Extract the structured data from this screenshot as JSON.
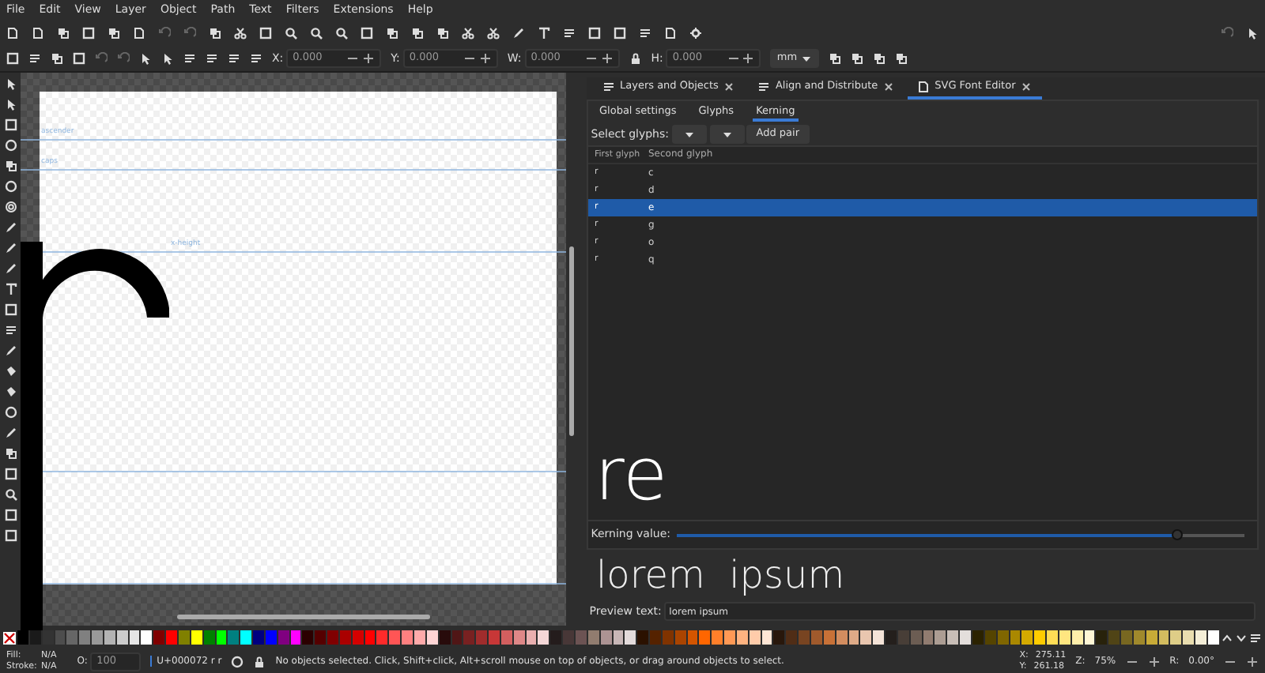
{
  "menu": [
    "File",
    "Edit",
    "View",
    "Layer",
    "Object",
    "Path",
    "Text",
    "Filters",
    "Extensions",
    "Help"
  ],
  "tool_controls": {
    "fields": [
      {
        "label": "X:",
        "value": "0.000"
      },
      {
        "label": "Y:",
        "value": "0.000"
      },
      {
        "label": "W:",
        "value": "0.000"
      },
      {
        "label": "H:",
        "value": "0.000"
      }
    ],
    "unit": "mm"
  },
  "canvas": {
    "guides": [
      {
        "label": "ascender"
      },
      {
        "label": "caps"
      },
      {
        "label": "x-height"
      }
    ]
  },
  "dock": {
    "tabs": [
      {
        "label": "Layers and Objects",
        "selected": false
      },
      {
        "label": "Align and Distribute",
        "selected": false
      },
      {
        "label": "SVG Font Editor",
        "selected": true
      }
    ],
    "subtabs": [
      {
        "label": "Global settings",
        "selected": false
      },
      {
        "label": "Glyphs",
        "selected": false
      },
      {
        "label": "Kerning",
        "selected": true
      }
    ],
    "select_label": "Select glyphs:",
    "add_pair": "Add pair",
    "columns": [
      "First glyph",
      "Second glyph"
    ],
    "rows": [
      {
        "first": "r",
        "second": "c",
        "selected": false
      },
      {
        "first": "r",
        "second": "d",
        "selected": false
      },
      {
        "first": "r",
        "second": "e",
        "selected": true
      },
      {
        "first": "r",
        "second": "g",
        "selected": false
      },
      {
        "first": "r",
        "second": "o",
        "selected": false
      },
      {
        "first": "r",
        "second": "q",
        "selected": false
      }
    ],
    "pair_preview": "re",
    "kerning": {
      "label": "Kerning value:",
      "level": 0.88
    },
    "text_preview": "lorem  ipsum",
    "preview_text": {
      "label": "Preview text:",
      "value": "lorem ipsum"
    }
  },
  "palette": [
    {
      "color": "#000000"
    },
    {
      "color": "#1a1a1a"
    },
    {
      "color": "#333333"
    },
    {
      "color": "#4d4d4d"
    },
    {
      "color": "#666666"
    },
    {
      "color": "#808080"
    },
    {
      "color": "#999999"
    },
    {
      "color": "#b3b3b3"
    },
    {
      "color": "#cccccc"
    },
    {
      "color": "#e6e6e6"
    },
    {
      "color": "#ffffff"
    },
    {
      "color": "#800000"
    },
    {
      "color": "#ff0000"
    },
    {
      "color": "#808000"
    },
    {
      "color": "#ffff00"
    },
    {
      "color": "#008000"
    },
    {
      "color": "#00ff00"
    },
    {
      "color": "#008080"
    },
    {
      "color": "#00ffff"
    },
    {
      "color": "#000080"
    },
    {
      "color": "#0000ff"
    },
    {
      "color": "#800080"
    },
    {
      "color": "#ff00ff"
    },
    {
      "color": "#2b0000"
    },
    {
      "color": "#550000"
    },
    {
      "color": "#800001"
    },
    {
      "color": "#aa0000"
    },
    {
      "color": "#d40000"
    },
    {
      "color": "#ff0001"
    },
    {
      "color": "#ff2a2a"
    },
    {
      "color": "#ff5555"
    },
    {
      "color": "#ff8080"
    },
    {
      "color": "#ffaaaa"
    },
    {
      "color": "#ffd5d5"
    },
    {
      "color": "#280b0b"
    },
    {
      "color": "#501616"
    },
    {
      "color": "#782121"
    },
    {
      "color": "#a02c2c"
    },
    {
      "color": "#c83737"
    },
    {
      "color": "#d35f5f"
    },
    {
      "color": "#de8787"
    },
    {
      "color": "#e9afaf"
    },
    {
      "color": "#f4d7d7"
    },
    {
      "color": "#241c1c"
    },
    {
      "color": "#483737"
    },
    {
      "color": "#6c5353"
    },
    {
      "color": "#917c6f"
    },
    {
      "color": "#ac9393"
    },
    {
      "color": "#c8b7b7"
    },
    {
      "color": "#e3dbdb"
    },
    {
      "color": "#2b1100"
    },
    {
      "color": "#552200"
    },
    {
      "color": "#803300"
    },
    {
      "color": "#aa4400"
    },
    {
      "color": "#d45500"
    },
    {
      "color": "#ff6600"
    },
    {
      "color": "#ff7f2a"
    },
    {
      "color": "#ff9955"
    },
    {
      "color": "#ffb380"
    },
    {
      "color": "#ffccaa"
    },
    {
      "color": "#ffe6d5"
    },
    {
      "color": "#28170b"
    },
    {
      "color": "#502d16"
    },
    {
      "color": "#784421"
    },
    {
      "color": "#a05a2c"
    },
    {
      "color": "#c87137"
    },
    {
      "color": "#d38d5f"
    },
    {
      "color": "#deaa87"
    },
    {
      "color": "#e9c6af"
    },
    {
      "color": "#f4e3d7"
    },
    {
      "color": "#241f1c"
    },
    {
      "color": "#483e37"
    },
    {
      "color": "#6c5d53"
    },
    {
      "color": "#917c70"
    },
    {
      "color": "#ac9d93"
    },
    {
      "color": "#c8beb7"
    },
    {
      "color": "#e3dedb"
    },
    {
      "color": "#2b2200"
    },
    {
      "color": "#554400"
    },
    {
      "color": "#806600"
    },
    {
      "color": "#aa8800"
    },
    {
      "color": "#d4aa00"
    },
    {
      "color": "#ffcc00"
    },
    {
      "color": "#ffdd55"
    },
    {
      "color": "#ffe680"
    },
    {
      "color": "#ffeeaa"
    },
    {
      "color": "#fff6d5"
    },
    {
      "color": "#28220b"
    },
    {
      "color": "#504416"
    },
    {
      "color": "#786721"
    },
    {
      "color": "#a0892c"
    },
    {
      "color": "#c8ab37"
    },
    {
      "color": "#d3bc5f"
    },
    {
      "color": "#decd87"
    },
    {
      "color": "#e9ddaf"
    },
    {
      "color": "#f4eed7"
    },
    {
      "color": "#fffffe"
    }
  ],
  "status": {
    "fill_label": "Fill:",
    "fill_value": "N/A",
    "stroke_label": "Stroke:",
    "stroke_value": "N/A",
    "opacity_label": "O:",
    "opacity_value": "100",
    "layer": "U+000072 r r",
    "message": "No objects selected. Click, Shift+click, Alt+scroll mouse on top of objects, or drag around objects to select.",
    "x_label": "X:",
    "x_value": "275.11",
    "y_label": "Y:",
    "y_value": "261.18",
    "zoom_label": "Z:",
    "zoom_value": "75%",
    "rotate_label": "R:",
    "rotate_value": "0.00°"
  }
}
